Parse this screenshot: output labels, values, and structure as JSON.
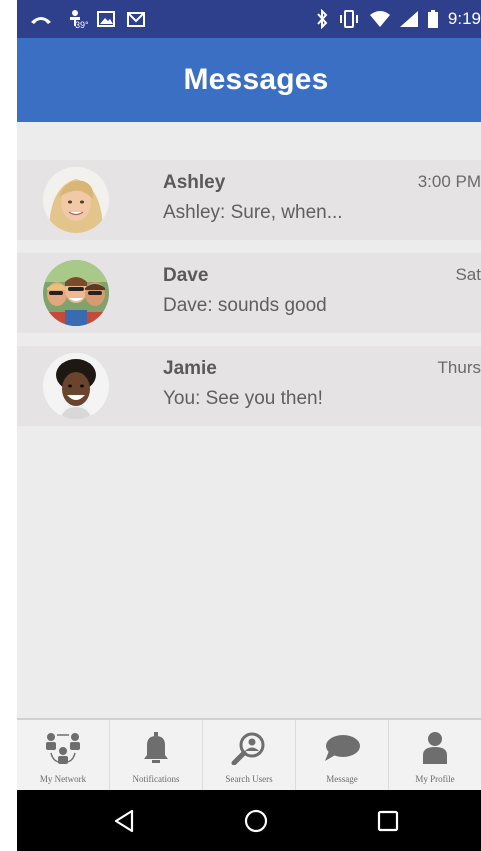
{
  "status_bar": {
    "time": "9:19",
    "left_icons": [
      "missed-call-icon",
      "weather-icon",
      "photo-icon",
      "gmail-icon"
    ],
    "temperature": "39°",
    "right_icons": [
      "bluetooth-icon",
      "vibrate-icon",
      "wifi-icon",
      "signal-icon",
      "battery-icon"
    ]
  },
  "header": {
    "title": "Messages"
  },
  "conversations": [
    {
      "name": "Ashley",
      "preview": "Ashley: Sure, when...",
      "time": "3:00 PM",
      "avatar": "ashley-avatar"
    },
    {
      "name": "Dave",
      "preview": "Dave: sounds good",
      "time": "Sat",
      "avatar": "dave-avatar"
    },
    {
      "name": "Jamie",
      "preview": "You: See you then!",
      "time": "Thurs",
      "avatar": "jamie-avatar"
    }
  ],
  "bottom_nav": [
    {
      "label": "My Network",
      "icon": "network-icon"
    },
    {
      "label": "Notifications",
      "icon": "bell-icon"
    },
    {
      "label": "Search Users",
      "icon": "search-users-icon"
    },
    {
      "label": "Message",
      "icon": "chat-bubble-icon"
    },
    {
      "label": "My Profile",
      "icon": "profile-icon"
    }
  ],
  "system_nav": [
    "back-icon",
    "home-icon",
    "recents-icon"
  ],
  "colors": {
    "status_bar": "#2e3f8c",
    "app_bar": "#3b6fc4",
    "background": "#ececec",
    "row": "#e5e3e3",
    "nav_bar": "#000000"
  }
}
